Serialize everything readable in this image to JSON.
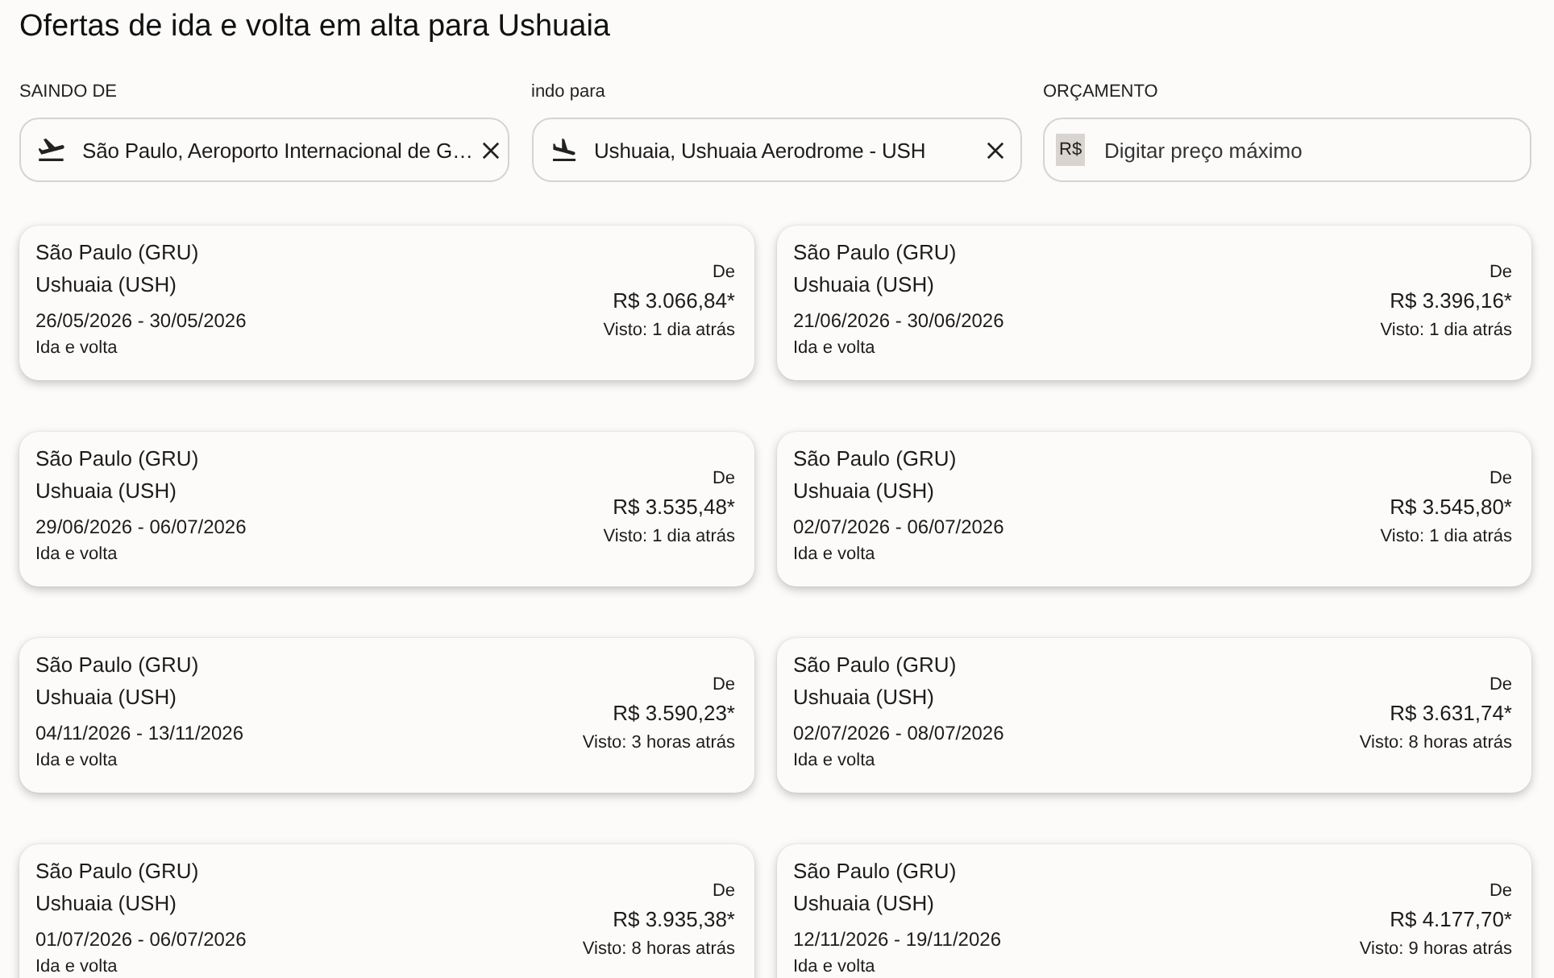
{
  "title": "Ofertas de ida e volta em alta para Ushuaia",
  "filters": [
    {
      "kind": "departure",
      "label": "SAINDO DE",
      "value": "São Paulo, Aeroporto Internacional de G…"
    },
    {
      "kind": "arrival",
      "label": "indo para",
      "value": "Ushuaia, Ushuaia Aerodrome - USH"
    },
    {
      "kind": "budget",
      "label": "ORÇAMENTO",
      "prefix": "R$",
      "placeholder": "Digitar preço máximo"
    }
  ],
  "deals": [
    {
      "origin": "São Paulo (GRU)",
      "destination": "Ushuaia (USH)",
      "dates": "26/05/2026 - 30/05/2026",
      "trip_type": "Ida e volta",
      "from_label": "De",
      "price": "R$ 3.066,84*",
      "seen": "Visto: 1 dia atrás"
    },
    {
      "origin": "São Paulo (GRU)",
      "destination": "Ushuaia (USH)",
      "dates": "21/06/2026 - 30/06/2026",
      "trip_type": "Ida e volta",
      "from_label": "De",
      "price": "R$ 3.396,16*",
      "seen": "Visto: 1 dia atrás"
    },
    {
      "origin": "São Paulo (GRU)",
      "destination": "Ushuaia (USH)",
      "dates": "29/06/2026 - 06/07/2026",
      "trip_type": "Ida e volta",
      "from_label": "De",
      "price": "R$ 3.535,48*",
      "seen": "Visto: 1 dia atrás"
    },
    {
      "origin": "São Paulo (GRU)",
      "destination": "Ushuaia (USH)",
      "dates": "02/07/2026 - 06/07/2026",
      "trip_type": "Ida e volta",
      "from_label": "De",
      "price": "R$ 3.545,80*",
      "seen": "Visto: 1 dia atrás"
    },
    {
      "origin": "São Paulo (GRU)",
      "destination": "Ushuaia (USH)",
      "dates": "04/11/2026 - 13/11/2026",
      "trip_type": "Ida e volta",
      "from_label": "De",
      "price": "R$ 3.590,23*",
      "seen": "Visto: 3 horas atrás"
    },
    {
      "origin": "São Paulo (GRU)",
      "destination": "Ushuaia (USH)",
      "dates": "02/07/2026 - 08/07/2026",
      "trip_type": "Ida e volta",
      "from_label": "De",
      "price": "R$ 3.631,74*",
      "seen": "Visto: 8 horas atrás"
    },
    {
      "origin": "São Paulo (GRU)",
      "destination": "Ushuaia (USH)",
      "dates": "01/07/2026 - 06/07/2026",
      "trip_type": "Ida e volta",
      "from_label": "De",
      "price": "R$ 3.935,38*",
      "seen": "Visto: 8 horas atrás"
    },
    {
      "origin": "São Paulo (GRU)",
      "destination": "Ushuaia (USH)",
      "dates": "12/11/2026 - 19/11/2026",
      "trip_type": "Ida e volta",
      "from_label": "De",
      "price": "R$ 4.177,70*",
      "seen": "Visto: 9 horas atrás"
    }
  ]
}
